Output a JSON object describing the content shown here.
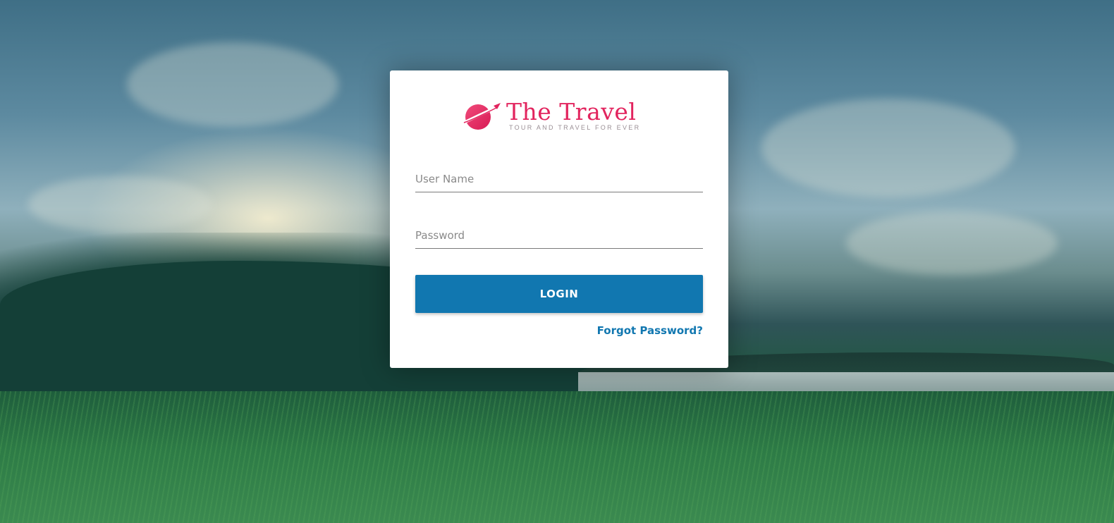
{
  "brand": {
    "name": "The Travel",
    "tagline": "TOUR AND TRAVEL FOR EVER",
    "logo_icon": "planet-plane-icon",
    "color": "#e2245e"
  },
  "login_form": {
    "username_placeholder": "User Name",
    "username_value": "",
    "password_placeholder": "Password",
    "password_value": "",
    "login_label": "LOGIN",
    "forgot_label": "Forgot Password?"
  },
  "colors": {
    "primary": "#1177b0",
    "brand": "#e2245e",
    "card_bg": "#ffffff"
  }
}
